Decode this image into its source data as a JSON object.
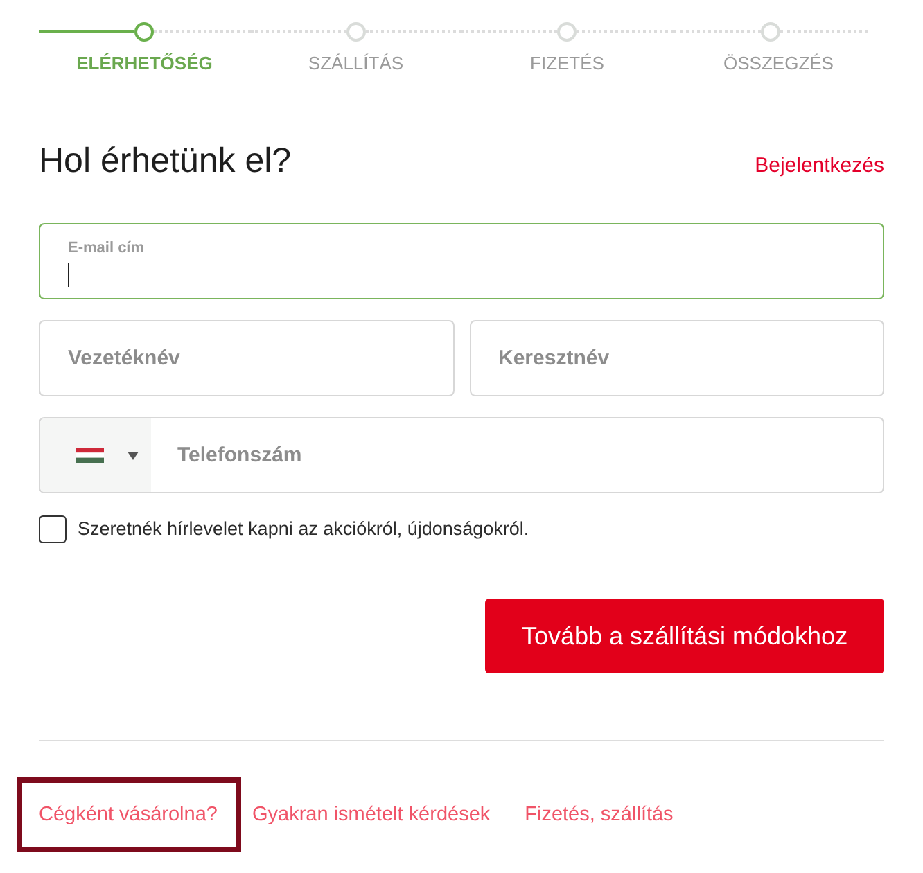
{
  "steps": [
    {
      "label": "ELÉRHETŐSÉG",
      "selected": true
    },
    {
      "label": "SZÁLLÍTÁS",
      "selected": false
    },
    {
      "label": "FIZETÉS",
      "selected": false
    },
    {
      "label": "ÖSSZEGZÉS",
      "selected": false
    }
  ],
  "heading": "Hol érhetünk el?",
  "login_link": "Bejelentkezés",
  "email_field": {
    "label": "E-mail cím",
    "focused": true
  },
  "name_fields": [
    {
      "placeholder": "Vezetéknév"
    },
    {
      "placeholder": "Keresztnév"
    }
  ],
  "phone_field": {
    "placeholder": "Telefonszám"
  },
  "newsletter": {
    "label": "Szeretnék hírlevelet kapni az akciókról, újdonságokról.",
    "checked": false
  },
  "continue_button": "Tovább a szállítási módokhoz",
  "footer_links": [
    {
      "label": "Cégként vásárolna?",
      "highlighted": true
    },
    {
      "label": "Gyakran ismételt kérdések",
      "highlighted": false
    },
    {
      "label": "Fizetés, szállítás",
      "highlighted": false
    }
  ]
}
